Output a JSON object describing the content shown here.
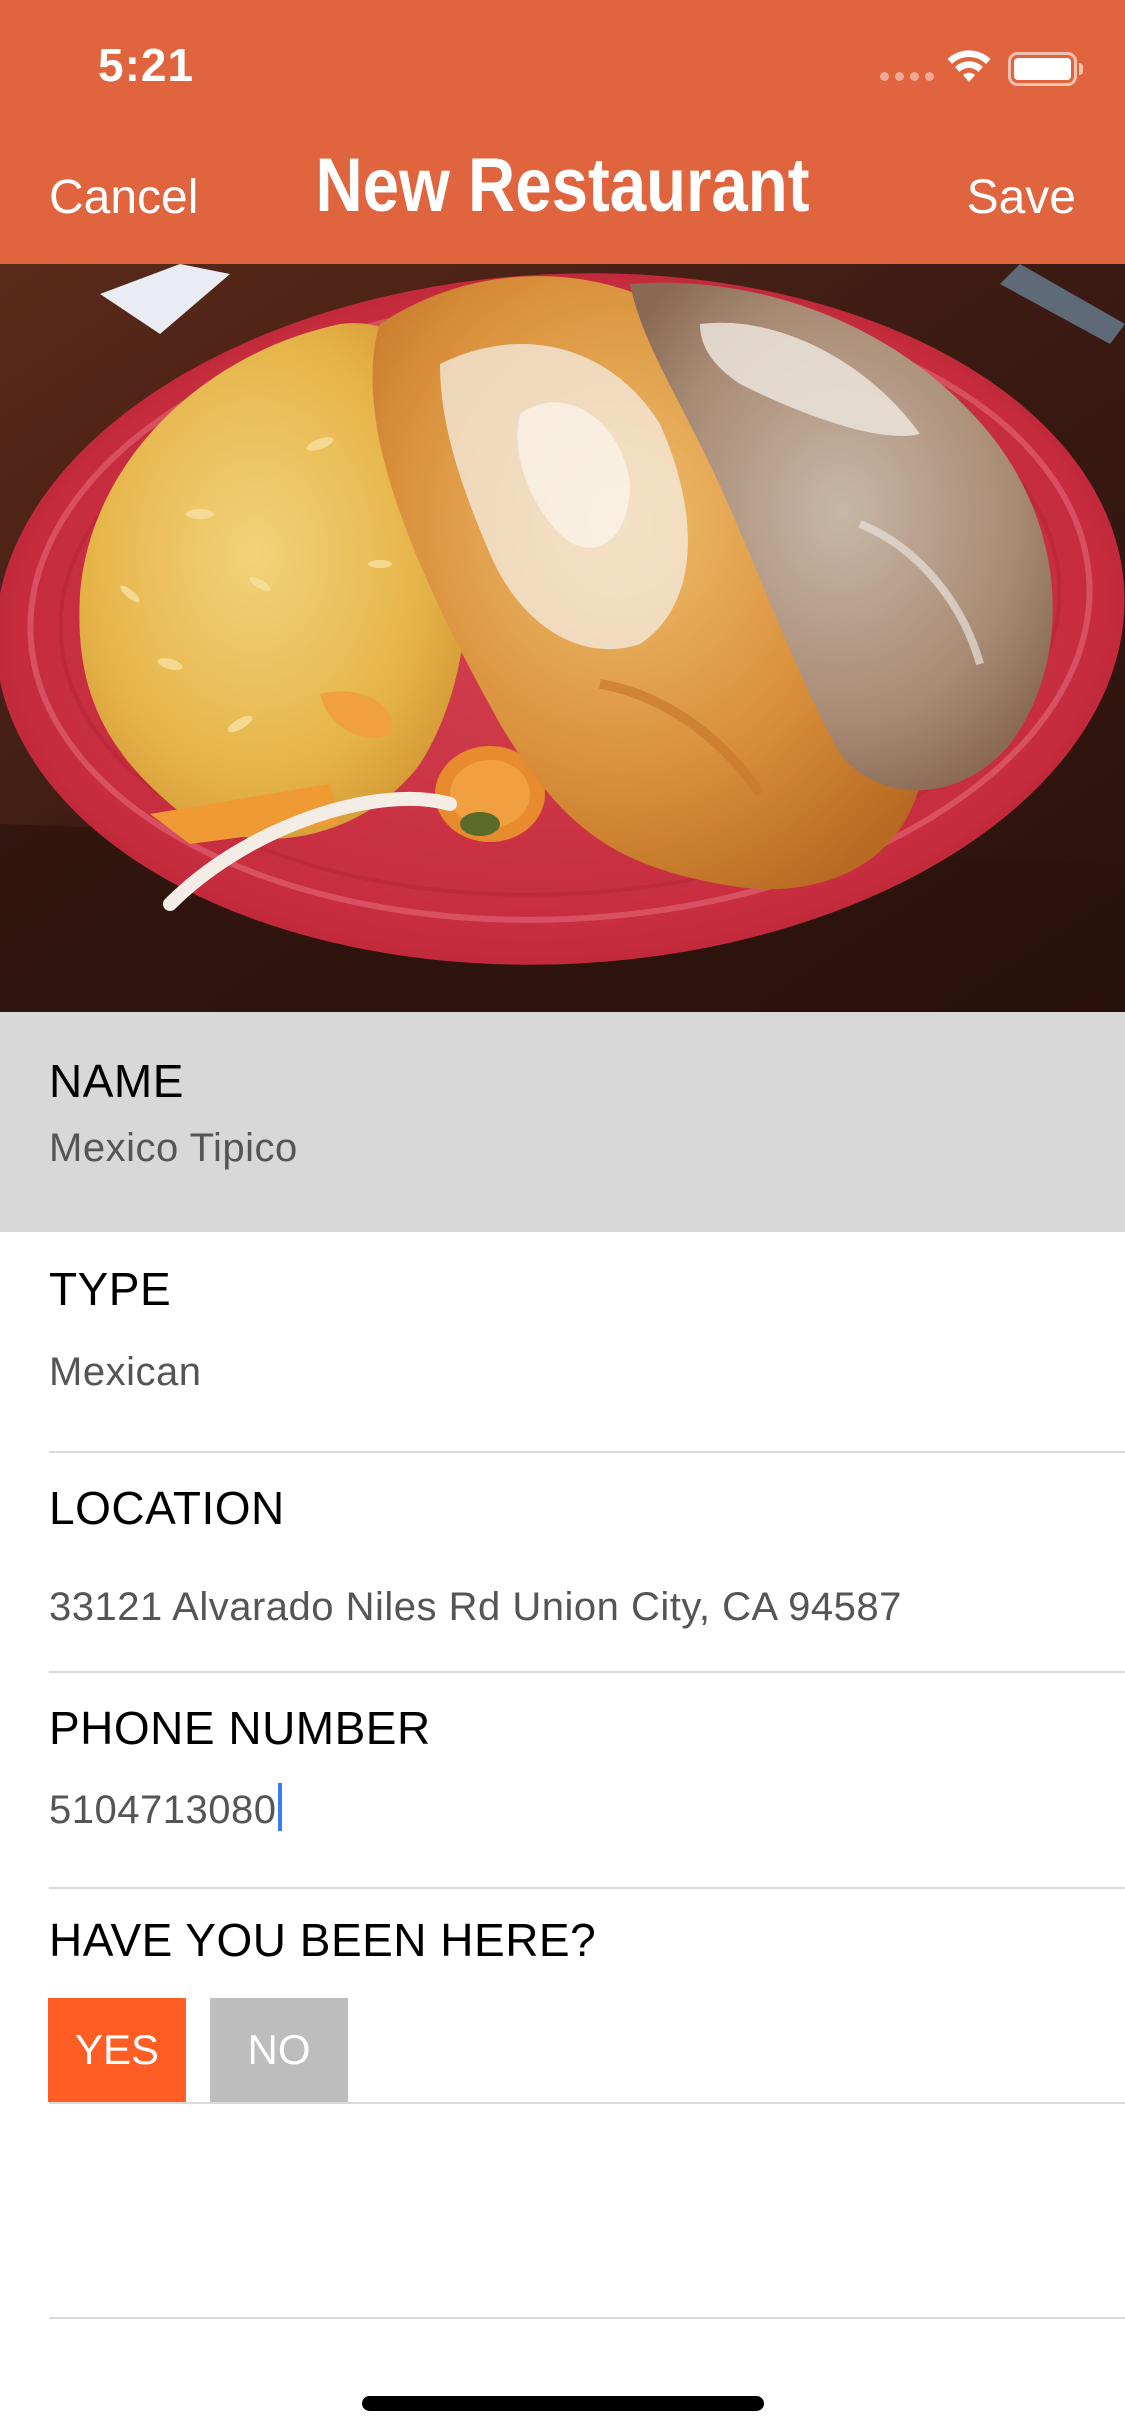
{
  "status_bar": {
    "time": "5:21",
    "icons": [
      "signal-icon",
      "wifi-icon",
      "battery-icon"
    ]
  },
  "nav": {
    "cancel_label": "Cancel",
    "title": "New Restaurant",
    "save_label": "Save",
    "background_color": "#E0643E"
  },
  "photo": {
    "subject": "restaurant-photo"
  },
  "form": {
    "name": {
      "label": "NAME",
      "value": "Mexico Tipico"
    },
    "type": {
      "label": "TYPE",
      "value": "Mexican"
    },
    "location": {
      "label": "LOCATION",
      "value": "33121 Alvarado Niles Rd Union City, CA 94587"
    },
    "phone": {
      "label": "PHONE NUMBER",
      "value": "5104713080"
    },
    "been_here": {
      "label": "HAVE YOU BEEN HERE?",
      "yes_label": "YES",
      "no_label": "NO",
      "selected": "YES",
      "yes_color": "#FE5D24",
      "no_color": "#BDBDBD"
    }
  }
}
